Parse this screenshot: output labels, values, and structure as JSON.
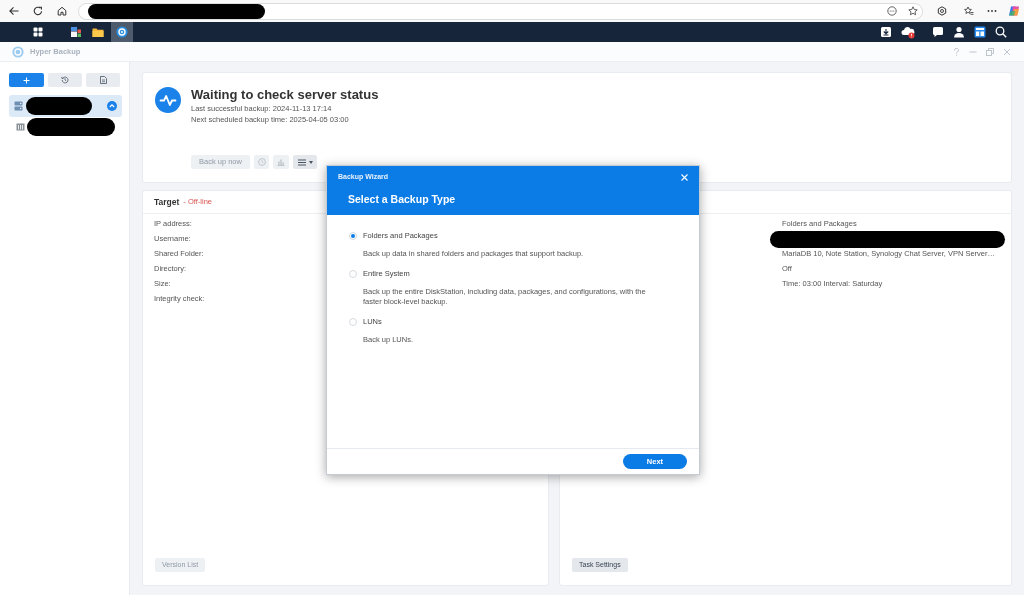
{
  "window": {
    "title": "Hyper Backup"
  },
  "taskbar": {
    "apps": [
      {
        "kind": "grid",
        "selected": false
      },
      {
        "kind": "package",
        "selected": false
      },
      {
        "kind": "folder",
        "selected": false
      },
      {
        "kind": "backup",
        "selected": true
      }
    ]
  },
  "sidebar": {
    "items": [
      {
        "kind": "server",
        "selected": true,
        "badge": true
      },
      {
        "kind": "drive",
        "selected": false,
        "badge": false
      }
    ]
  },
  "status": {
    "title": "Waiting to check server status",
    "lines": [
      "Last successful backup: 2024-11-13 17:14",
      "Next scheduled backup time: 2025-04-05 03:00"
    ],
    "buttons": [
      {
        "kind": "text",
        "label": "Back up now",
        "disabled": true
      },
      {
        "kind": "clock",
        "disabled": true
      },
      {
        "kind": "chart",
        "disabled": true
      },
      {
        "kind": "menu",
        "disabled": false
      }
    ]
  },
  "target_panel": {
    "title": "Target",
    "status": "- Off-line",
    "labels": [
      "IP address:",
      "Username:",
      "Shared Folder:",
      "Directory:",
      "Size:",
      "Integrity check:"
    ],
    "button": {
      "label": "Version List",
      "disabled": true
    }
  },
  "task_panel": {
    "values": [
      {
        "kind": "text",
        "text": "Folders and Packages"
      },
      {
        "kind": "redacted"
      },
      {
        "kind": "text",
        "text": "MariaDB 10, Note Station, Synology Chat Server, VPN Server…"
      },
      {
        "kind": "text",
        "text": "Off"
      },
      {
        "kind": "text",
        "text": "Time: 03:00 Interval: Saturday"
      }
    ],
    "button": {
      "label": "Task Settings",
      "disabled": false
    }
  },
  "dialog": {
    "title": "Backup Wizard",
    "heading": "Select a Backup Type",
    "options": [
      {
        "label": "Folders and Packages",
        "description": "Back up data in shared folders and packages that support backup.",
        "selected": true
      },
      {
        "label": "Entire System",
        "description": "Back up the entire DiskStation, including data, packages, and configurations, with the faster block-level backup.",
        "selected": false
      },
      {
        "label": "LUNs",
        "description": "Back up LUNs.",
        "selected": false
      }
    ],
    "buttons": [
      {
        "label": "Next"
      }
    ]
  }
}
